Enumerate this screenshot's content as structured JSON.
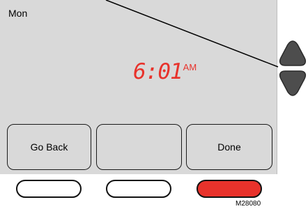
{
  "display": {
    "day": "Mon",
    "time": "6:01",
    "ampm": "AM",
    "time_color": "#e8322b",
    "screen_color": "#d9d9d9"
  },
  "softkeys": [
    {
      "label": "Go Back"
    },
    {
      "label": ""
    },
    {
      "label": "Done"
    }
  ],
  "arrows": {
    "up": "up-arrow-icon",
    "down": "down-arrow-icon"
  },
  "indicators": [
    {
      "color": "#ffffff"
    },
    {
      "color": "#ffffff"
    },
    {
      "color": "#e8322b"
    }
  ],
  "figure_code": "M28080"
}
